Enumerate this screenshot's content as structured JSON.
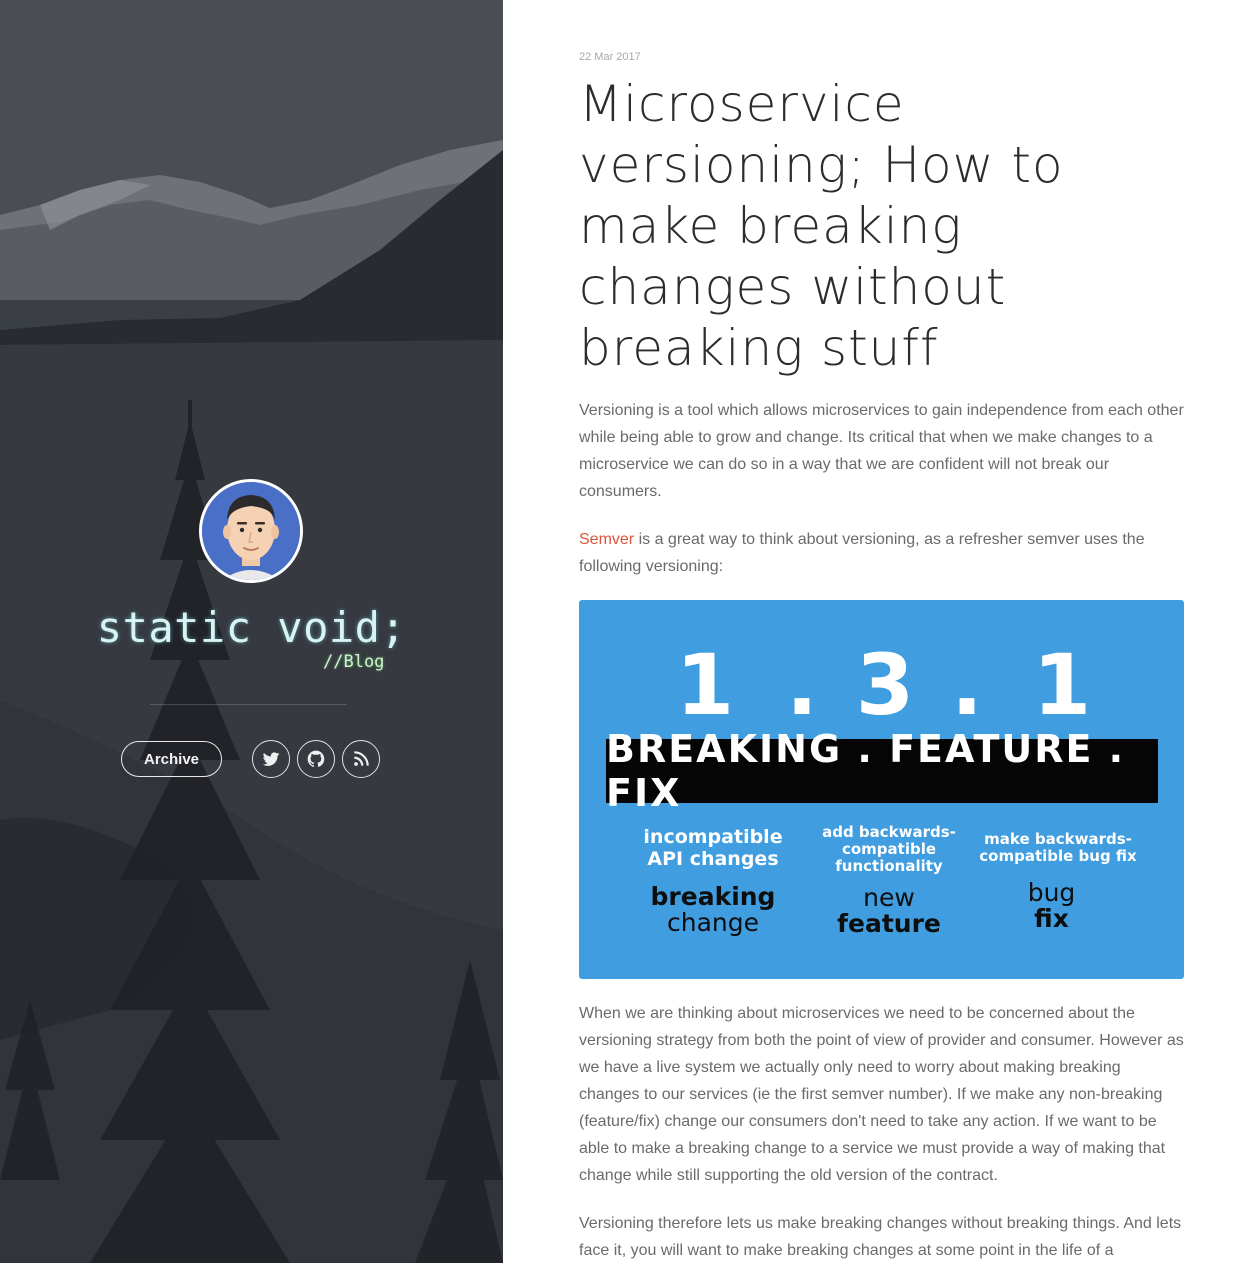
{
  "sidebar": {
    "site_title": "static void;",
    "site_subtitle": "//Blog",
    "archive_label": "Archive",
    "social_icons": [
      "twitter-icon",
      "github-icon",
      "rss-icon"
    ]
  },
  "post": {
    "date": "22 Mar 2017",
    "title": "Microservice versioning; How to make breaking changes without breaking stuff",
    "paragraphs": {
      "p1": "Versioning is a tool which allows microservices to gain independence from each other while being able to grow and change. Its critical that when we make changes to a microservice we can do so in a way that we are confident will not break our consumers.",
      "p2_link": "Semver",
      "p2_rest": " is a great way to think about versioning, as a refresher semver uses the following versioning:",
      "p3": "When we are thinking about microservices we need to be concerned about the versioning strategy from both the point of view of provider and consumer. However as we have a live system we actually only need to worry about making breaking changes to our services (ie the first semver number). If we make any non-breaking (feature/fix) change our consumers don't need to take any action. If we want to be able to make a breaking change to a service we must provide a way of making that change while still supporting the old version of the contract.",
      "p4": "Versioning therefore lets us make breaking changes without breaking things. And lets face it, you will want to make breaking changes at some point in the life of a"
    }
  },
  "semver_figure": {
    "numbers": [
      "1",
      ".",
      "3",
      ".",
      "1"
    ],
    "bar_text": "BREAKING . FEATURE . FIX",
    "columns": [
      {
        "desc": "incompatible API changes",
        "label_top": "breaking",
        "label_bottom": "change"
      },
      {
        "desc": "add backwards- compatible functionality",
        "label_top": "new",
        "label_bottom": "feature"
      },
      {
        "desc": "make backwards- compatible bug fix",
        "label_top": "bug",
        "label_bottom": "fix"
      }
    ],
    "background_color": "#3f9de0"
  },
  "colors": {
    "link": "#d9553b",
    "body_text": "#6a6a6a",
    "title_text": "#2c2c2c"
  }
}
